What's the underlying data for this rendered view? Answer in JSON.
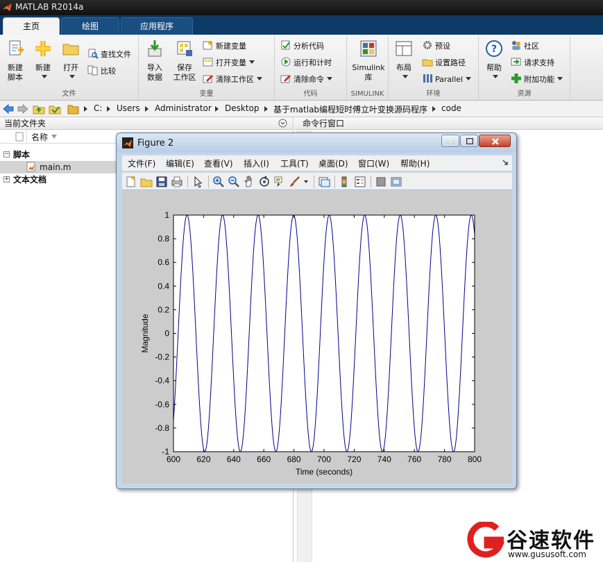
{
  "app": {
    "title": "MATLAB R2014a",
    "tabs": [
      {
        "label": "主页",
        "active": true
      },
      {
        "label": "绘图",
        "active": false
      },
      {
        "label": "应用程序",
        "active": false
      }
    ]
  },
  "ribbon": {
    "file_group": {
      "label": "文件",
      "new_script": "新建\n脚本",
      "new": "新建",
      "open": "打开",
      "find_files": "查找文件",
      "compare": "比较"
    },
    "variable_group": {
      "label": "变量",
      "import_data": "导入\n数据",
      "save_workspace": "保存\n工作区",
      "new_variable": "新建变量",
      "open_variable": "打开变量",
      "clear_workspace": "清除工作区"
    },
    "code_group": {
      "label": "代码",
      "analyze_code": "分析代码",
      "run_and_time": "运行和计时",
      "clear_commands": "清除命令"
    },
    "simulink_group": {
      "label": "SIMULINK",
      "library": "Simulink\n库"
    },
    "env_group": {
      "label": "环境",
      "layout": "布局",
      "preferences": "预设",
      "set_path": "设置路径",
      "parallel": "Parallel"
    },
    "resources_group": {
      "label": "资源",
      "help": "帮助",
      "community": "社区",
      "request_support": "请求支持",
      "addons": "附加功能"
    }
  },
  "address": {
    "crumbs": [
      "C:",
      "Users",
      "Administrator",
      "Desktop",
      "基于matlab编程短时傅立叶变换源码程序",
      "code"
    ]
  },
  "left_panel": {
    "title": "当前文件夹",
    "column_name": "名称",
    "tree": [
      {
        "label": "脚本",
        "type": "group",
        "expanded": true
      },
      {
        "label": "main.m",
        "type": "file",
        "selected": true
      },
      {
        "label": "文本文档",
        "type": "group",
        "expanded": false
      }
    ]
  },
  "right_panel": {
    "title": "命令行窗口"
  },
  "figure": {
    "title": "Figure 2",
    "menus": [
      "文件(F)",
      "编辑(E)",
      "查看(V)",
      "插入(I)",
      "工具(T)",
      "桌面(D)",
      "窗口(W)",
      "帮助(H)"
    ]
  },
  "chart_data": {
    "type": "line",
    "title": "",
    "xlabel": "Time (seconds)",
    "ylabel": "Magnitude",
    "xlim": [
      600,
      800
    ],
    "ylim": [
      -1,
      1
    ],
    "xticks": [
      600,
      620,
      640,
      660,
      680,
      700,
      720,
      740,
      760,
      780,
      800
    ],
    "yticks": [
      1,
      0.8,
      0.6,
      0.4,
      0.2,
      0,
      -0.2,
      -0.4,
      -0.6,
      -0.8,
      -1
    ],
    "series": [
      {
        "function": "sin",
        "amplitude": 1,
        "period": 23.6,
        "peaks_x": [
          609,
          632.6,
          656.2,
          679.8,
          703.4,
          727,
          750.6,
          774.2,
          797.8
        ],
        "color": "#00008B"
      }
    ],
    "grid": false,
    "legend": "none"
  },
  "watermark": {
    "text": "谷速软件",
    "url": "www.gususoft.com",
    "accent": "#e02020"
  },
  "colors": {
    "tab_bar": "#0d3a66",
    "figure_frame": "#c4d6ea",
    "plot_line": "#00008B"
  }
}
